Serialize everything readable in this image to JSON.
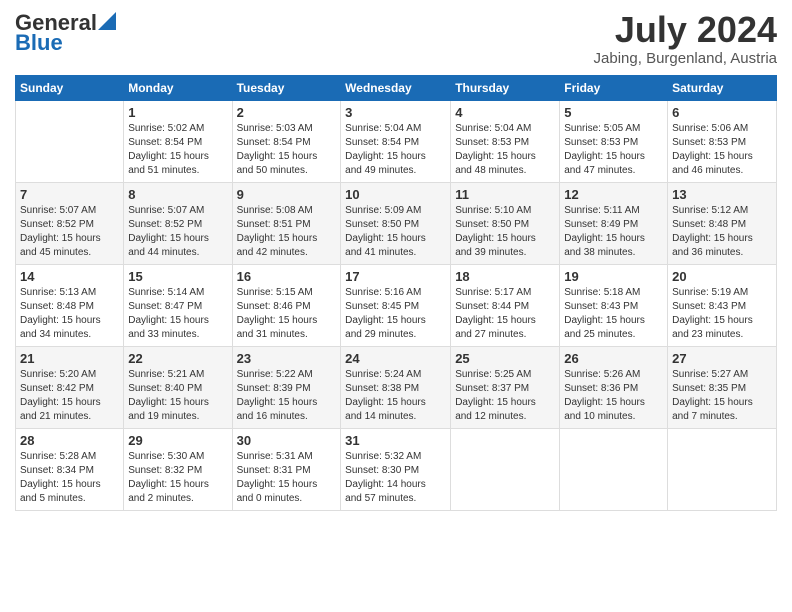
{
  "header": {
    "logo_line1": "General",
    "logo_line2": "Blue",
    "month_year": "July 2024",
    "location": "Jabing, Burgenland, Austria"
  },
  "days_of_week": [
    "Sunday",
    "Monday",
    "Tuesday",
    "Wednesday",
    "Thursday",
    "Friday",
    "Saturday"
  ],
  "weeks": [
    [
      {
        "day": "",
        "info": ""
      },
      {
        "day": "1",
        "info": "Sunrise: 5:02 AM\nSunset: 8:54 PM\nDaylight: 15 hours\nand 51 minutes."
      },
      {
        "day": "2",
        "info": "Sunrise: 5:03 AM\nSunset: 8:54 PM\nDaylight: 15 hours\nand 50 minutes."
      },
      {
        "day": "3",
        "info": "Sunrise: 5:04 AM\nSunset: 8:54 PM\nDaylight: 15 hours\nand 49 minutes."
      },
      {
        "day": "4",
        "info": "Sunrise: 5:04 AM\nSunset: 8:53 PM\nDaylight: 15 hours\nand 48 minutes."
      },
      {
        "day": "5",
        "info": "Sunrise: 5:05 AM\nSunset: 8:53 PM\nDaylight: 15 hours\nand 47 minutes."
      },
      {
        "day": "6",
        "info": "Sunrise: 5:06 AM\nSunset: 8:53 PM\nDaylight: 15 hours\nand 46 minutes."
      }
    ],
    [
      {
        "day": "7",
        "info": "Sunrise: 5:07 AM\nSunset: 8:52 PM\nDaylight: 15 hours\nand 45 minutes."
      },
      {
        "day": "8",
        "info": "Sunrise: 5:07 AM\nSunset: 8:52 PM\nDaylight: 15 hours\nand 44 minutes."
      },
      {
        "day": "9",
        "info": "Sunrise: 5:08 AM\nSunset: 8:51 PM\nDaylight: 15 hours\nand 42 minutes."
      },
      {
        "day": "10",
        "info": "Sunrise: 5:09 AM\nSunset: 8:50 PM\nDaylight: 15 hours\nand 41 minutes."
      },
      {
        "day": "11",
        "info": "Sunrise: 5:10 AM\nSunset: 8:50 PM\nDaylight: 15 hours\nand 39 minutes."
      },
      {
        "day": "12",
        "info": "Sunrise: 5:11 AM\nSunset: 8:49 PM\nDaylight: 15 hours\nand 38 minutes."
      },
      {
        "day": "13",
        "info": "Sunrise: 5:12 AM\nSunset: 8:48 PM\nDaylight: 15 hours\nand 36 minutes."
      }
    ],
    [
      {
        "day": "14",
        "info": "Sunrise: 5:13 AM\nSunset: 8:48 PM\nDaylight: 15 hours\nand 34 minutes."
      },
      {
        "day": "15",
        "info": "Sunrise: 5:14 AM\nSunset: 8:47 PM\nDaylight: 15 hours\nand 33 minutes."
      },
      {
        "day": "16",
        "info": "Sunrise: 5:15 AM\nSunset: 8:46 PM\nDaylight: 15 hours\nand 31 minutes."
      },
      {
        "day": "17",
        "info": "Sunrise: 5:16 AM\nSunset: 8:45 PM\nDaylight: 15 hours\nand 29 minutes."
      },
      {
        "day": "18",
        "info": "Sunrise: 5:17 AM\nSunset: 8:44 PM\nDaylight: 15 hours\nand 27 minutes."
      },
      {
        "day": "19",
        "info": "Sunrise: 5:18 AM\nSunset: 8:43 PM\nDaylight: 15 hours\nand 25 minutes."
      },
      {
        "day": "20",
        "info": "Sunrise: 5:19 AM\nSunset: 8:43 PM\nDaylight: 15 hours\nand 23 minutes."
      }
    ],
    [
      {
        "day": "21",
        "info": "Sunrise: 5:20 AM\nSunset: 8:42 PM\nDaylight: 15 hours\nand 21 minutes."
      },
      {
        "day": "22",
        "info": "Sunrise: 5:21 AM\nSunset: 8:40 PM\nDaylight: 15 hours\nand 19 minutes."
      },
      {
        "day": "23",
        "info": "Sunrise: 5:22 AM\nSunset: 8:39 PM\nDaylight: 15 hours\nand 16 minutes."
      },
      {
        "day": "24",
        "info": "Sunrise: 5:24 AM\nSunset: 8:38 PM\nDaylight: 15 hours\nand 14 minutes."
      },
      {
        "day": "25",
        "info": "Sunrise: 5:25 AM\nSunset: 8:37 PM\nDaylight: 15 hours\nand 12 minutes."
      },
      {
        "day": "26",
        "info": "Sunrise: 5:26 AM\nSunset: 8:36 PM\nDaylight: 15 hours\nand 10 minutes."
      },
      {
        "day": "27",
        "info": "Sunrise: 5:27 AM\nSunset: 8:35 PM\nDaylight: 15 hours\nand 7 minutes."
      }
    ],
    [
      {
        "day": "28",
        "info": "Sunrise: 5:28 AM\nSunset: 8:34 PM\nDaylight: 15 hours\nand 5 minutes."
      },
      {
        "day": "29",
        "info": "Sunrise: 5:30 AM\nSunset: 8:32 PM\nDaylight: 15 hours\nand 2 minutes."
      },
      {
        "day": "30",
        "info": "Sunrise: 5:31 AM\nSunset: 8:31 PM\nDaylight: 15 hours\nand 0 minutes."
      },
      {
        "day": "31",
        "info": "Sunrise: 5:32 AM\nSunset: 8:30 PM\nDaylight: 14 hours\nand 57 minutes."
      },
      {
        "day": "",
        "info": ""
      },
      {
        "day": "",
        "info": ""
      },
      {
        "day": "",
        "info": ""
      }
    ]
  ]
}
